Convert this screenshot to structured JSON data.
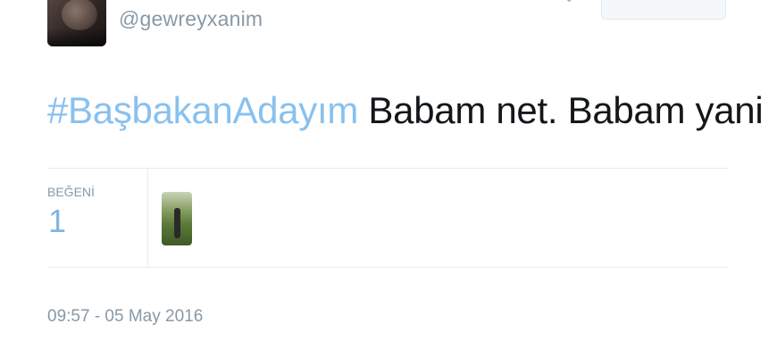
{
  "user": {
    "handle": "@gewreyxanim"
  },
  "tweet": {
    "hashtag": "#BaşbakanAdayım",
    "text": " Babam net. Babam yani"
  },
  "stats": {
    "likes_label": "BEĞENİ",
    "likes_count": "1"
  },
  "timestamp": "09:57 - 05 May 2016",
  "colors": {
    "hashtag": "#88c1ef",
    "muted": "#8899a6",
    "text": "#14171a"
  }
}
